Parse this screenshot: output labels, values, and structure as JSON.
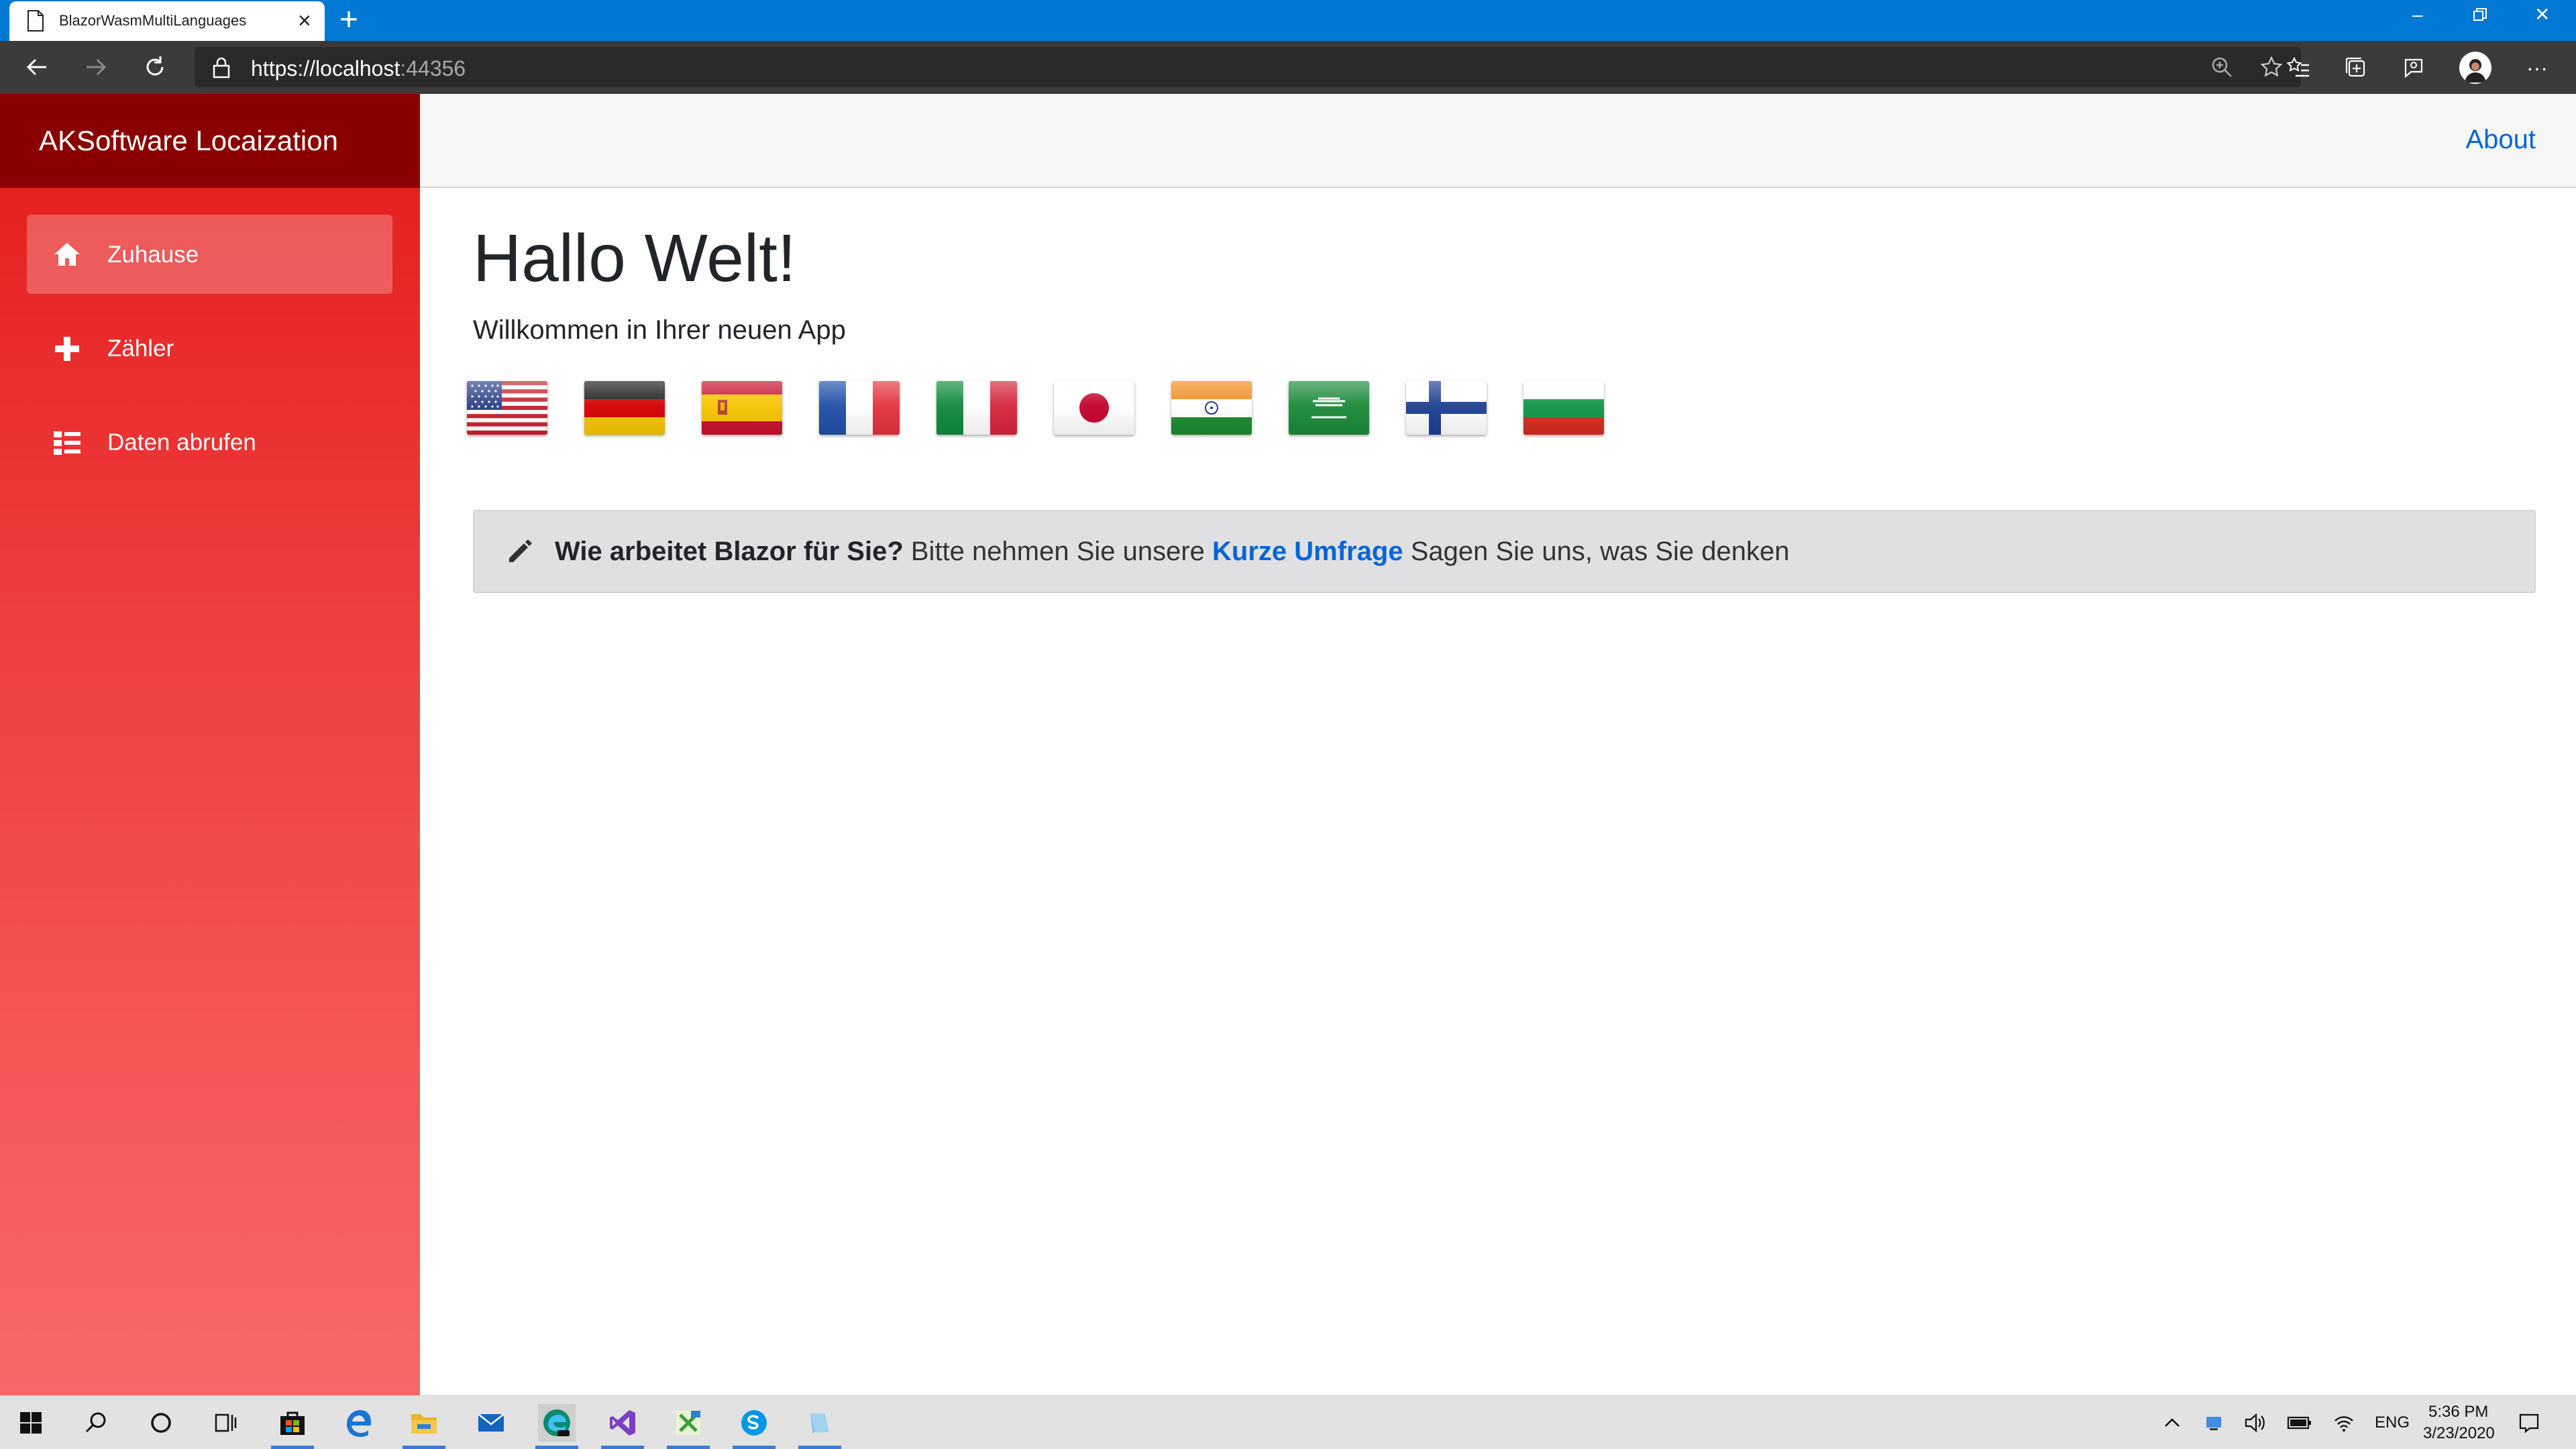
{
  "browser": {
    "tab_title": "BlazorWasmMultiLanguages",
    "new_tab": "+",
    "url_main": "https://localhost",
    "url_port": ":44356"
  },
  "app": {
    "brand": "AKSoftware Locaization",
    "about_link": "About",
    "nav": [
      {
        "label": "Zuhause",
        "icon": "home-icon",
        "active": true
      },
      {
        "label": "Zähler",
        "icon": "plus-icon",
        "active": false
      },
      {
        "label": "Daten abrufen",
        "icon": "list-icon",
        "active": false
      }
    ],
    "heading": "Hallo Welt!",
    "welcome": "Willkommen in Ihrer neuen App",
    "flags": [
      "United States",
      "Germany",
      "Spain",
      "France",
      "Italy",
      "Japan",
      "India",
      "Saudi Arabia",
      "Finland",
      "Bulgaria"
    ],
    "survey": {
      "question": "Wie arbeitet Blazor für Sie?",
      "lead": "Bitte nehmen Sie unsere",
      "link": "Kurze Umfrage",
      "tail": "Sagen Sie uns, was Sie denken"
    }
  },
  "taskbar": {
    "language": "ENG",
    "time": "5:36 PM",
    "date": "3/23/2020"
  },
  "colors": {
    "titlebar": "#0078d4",
    "brand_bg": "#8a0000",
    "sidebar_top": "#e41a1a",
    "sidebar_bottom": "#f86868",
    "link": "#0366d6"
  }
}
